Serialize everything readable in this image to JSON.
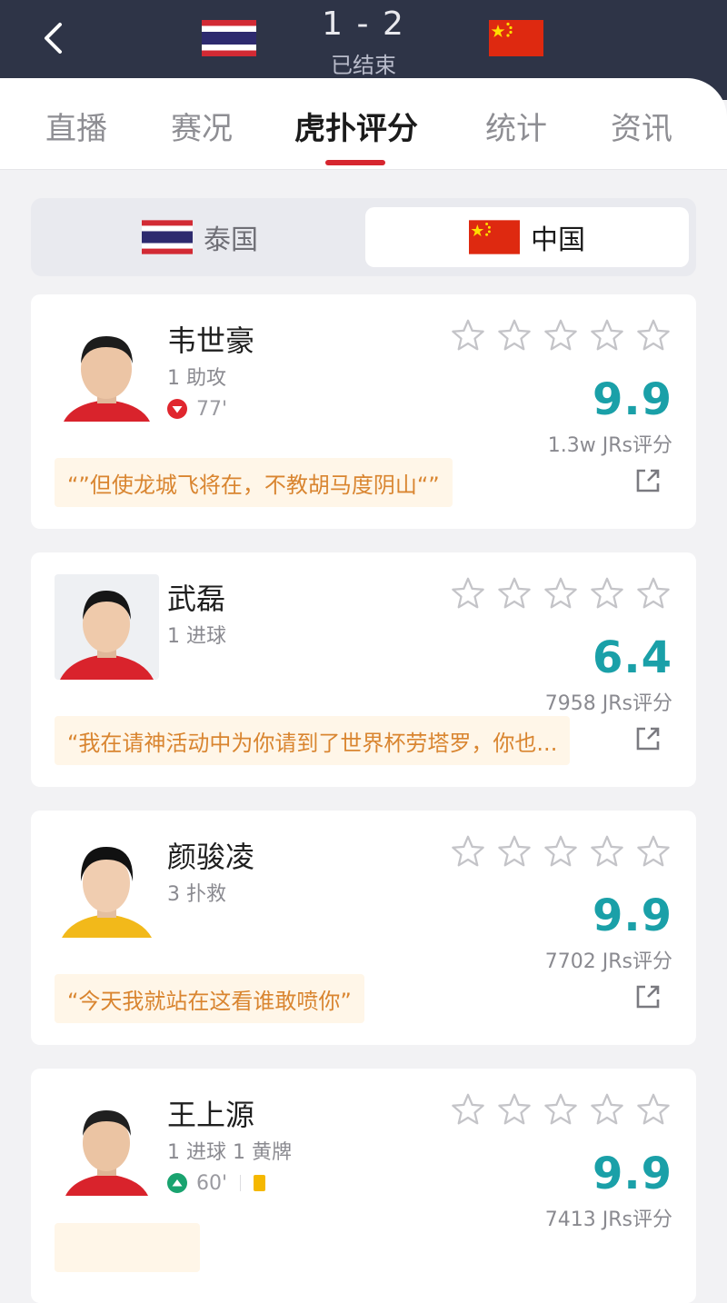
{
  "match": {
    "score": "1 - 2",
    "status": "已结束",
    "home_flag": "thailand-flag",
    "away_flag": "china-flag"
  },
  "tabs": [
    {
      "label": "直播",
      "active": false
    },
    {
      "label": "赛况",
      "active": false
    },
    {
      "label": "虎扑评分",
      "active": true
    },
    {
      "label": "统计",
      "active": false
    },
    {
      "label": "资讯",
      "active": false
    }
  ],
  "teams": {
    "left": {
      "name": "泰国",
      "selected": false
    },
    "right": {
      "name": "中国",
      "selected": true
    }
  },
  "players": [
    {
      "name": "韦世豪",
      "stats": "1 助攻",
      "sub_minute": "77'",
      "rating": "9.9",
      "count": "1.3w JRs评分",
      "comment": "“”但使龙城飞将在，不教胡马度阴山“”"
    },
    {
      "name": "武磊",
      "stats": "1 进球",
      "rating": "6.4",
      "count": "7958 JRs评分",
      "comment": "“我在请神活动中为你请到了世界杯劳塔罗，你也..."
    },
    {
      "name": "颜骏凌",
      "stats": "3 扑救",
      "rating": "9.9",
      "count": "7702 JRs评分",
      "comment": "“今天我就站在这看谁敢喷你”"
    },
    {
      "name": "王上源",
      "stats": "1 进球  1 黄牌",
      "sub_minute": "60'",
      "rating": "9.9",
      "count": "7413 JRs评分"
    }
  ],
  "colors": {
    "header_bg": "#2e3447",
    "accent_red": "#d6262f",
    "rating_teal": "#1aa0a8",
    "comment_text": "#d98530",
    "comment_bg": "#fff6e8",
    "sub_out": "#e0262e",
    "sub_in": "#19a36f",
    "yellow_card": "#f5b800"
  },
  "icons": {
    "back": "chevron-left-icon",
    "star": "star-outline-icon",
    "share": "share-external-icon",
    "sub_out": "substitution-out-icon",
    "sub_in": "substitution-in-icon",
    "yellow_card": "yellow-card-icon"
  }
}
